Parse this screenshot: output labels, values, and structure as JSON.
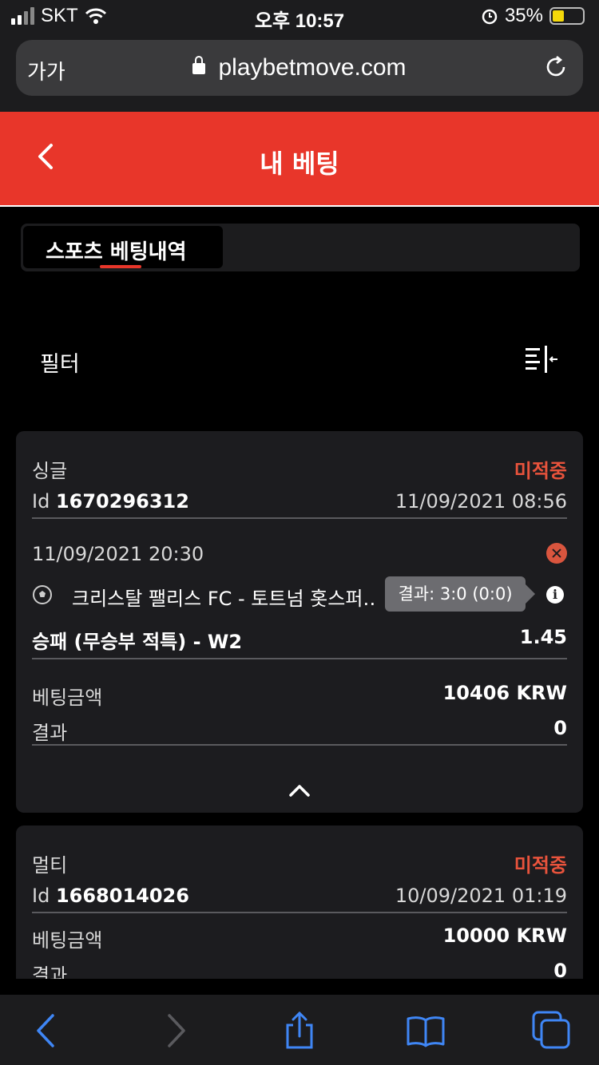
{
  "status_bar": {
    "carrier": "SKT",
    "time": "오후 10:57",
    "battery": "35%"
  },
  "browser": {
    "text_size": "가가",
    "url": "playbetmove.com"
  },
  "header": {
    "title": "내 베팅"
  },
  "tabs": [
    {
      "label": "스포츠 베팅내역",
      "active": true
    }
  ],
  "filter": {
    "label": "필터"
  },
  "bets": [
    {
      "type": "싱글",
      "status": "미적중",
      "id_label": "Id",
      "id": "1670296312",
      "placed": "11/09/2021 08:56",
      "event": {
        "datetime": "11/09/2021 20:30",
        "match": "크리스탈 팰리스 FC - 토트넘 홋스퍼…",
        "tooltip": "결과: 3:0 (0:0)",
        "market": "승패 (무승부 적특) - W2",
        "odds": "1.45"
      },
      "stake_label": "베팅금액",
      "stake": "10406 KRW",
      "result_label": "결과",
      "result": "0"
    },
    {
      "type": "멀티",
      "status": "미적중",
      "id_label": "Id",
      "id": "1668014026",
      "placed": "10/09/2021 01:19",
      "stake_label": "베팅금액",
      "stake": "10000 KRW",
      "result_label": "결과",
      "result": "0"
    }
  ],
  "colors": {
    "accent": "#e8362a",
    "status_lost": "#e8533c",
    "card_bg": "#1c1c1f",
    "ios_blue": "#3f86f5"
  },
  "icons": [
    "back-chevron-icon",
    "lock-icon",
    "reload-icon",
    "filter-icon",
    "close-circle-icon",
    "soccer-ball-icon",
    "info-icon",
    "chevron-up-icon",
    "nav-back-icon",
    "nav-forward-icon",
    "share-icon",
    "bookmarks-icon",
    "tabs-icon"
  ]
}
